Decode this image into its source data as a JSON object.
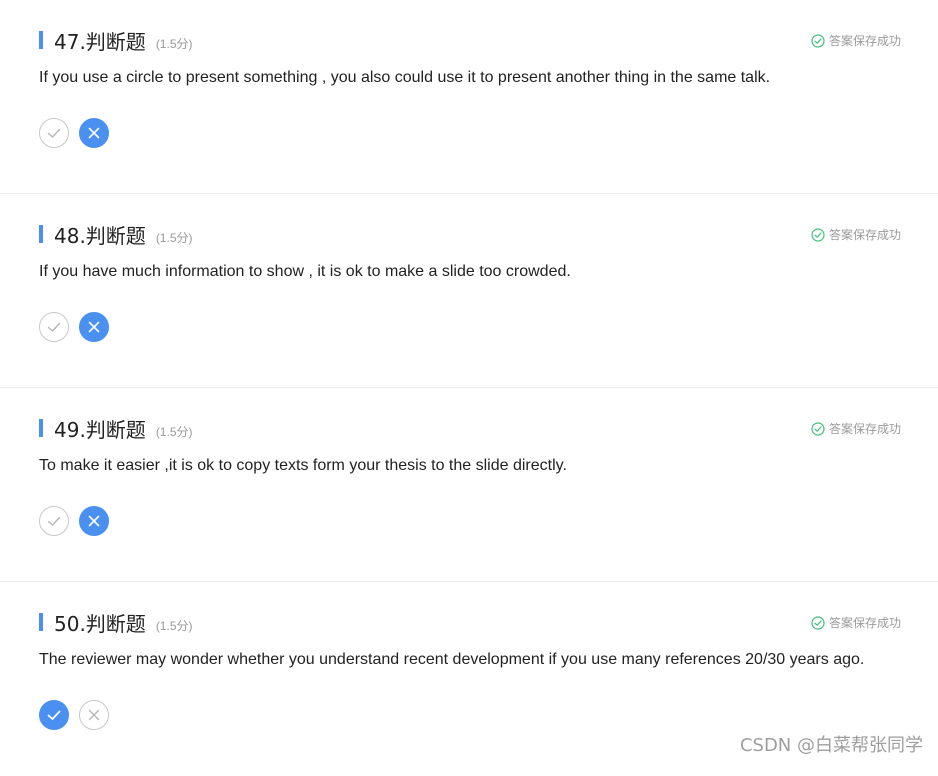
{
  "questions": [
    {
      "title": "47.判断题",
      "score": "(1.5分)",
      "status": "答案保存成功",
      "text": "If you use a circle to present something , you also could use it to present another thing in the same talk.",
      "selected": "false"
    },
    {
      "title": "48.判断题",
      "score": "(1.5分)",
      "status": "答案保存成功",
      "text": "If you have much information to show , it is ok to make a slide too crowded.",
      "selected": "false"
    },
    {
      "title": "49.判断题",
      "score": "(1.5分)",
      "status": "答案保存成功",
      "text": "To make it easier ,it is ok to copy texts form your thesis to the slide directly.",
      "selected": "false"
    },
    {
      "title": "50.判断题",
      "score": "(1.5分)",
      "status": "答案保存成功",
      "text": "The reviewer may wonder whether you understand recent development if you use many references 20/30 years ago.",
      "selected": "true"
    }
  ],
  "watermark": "CSDN @白菜帮张同学",
  "colors": {
    "accent": "#4a90f0",
    "success": "#3fbf7f",
    "muted": "#999999"
  }
}
